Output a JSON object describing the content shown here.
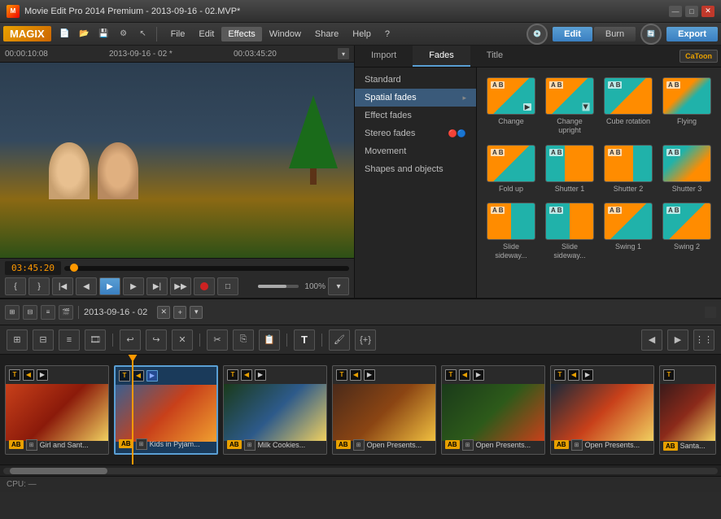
{
  "window": {
    "title": "Movie Edit Pro 2014 Premium - 2013-09-16 - 02.MVP*",
    "controls": [
      "—",
      "□",
      "✕"
    ]
  },
  "menu": {
    "logo": "MAGIX",
    "file": "File",
    "edit": "Edit",
    "effects": "Effects",
    "window": "Window",
    "share": "Share",
    "help": "Help",
    "edit_btn": "Edit",
    "burn_btn": "Burn",
    "export_btn": "Export"
  },
  "video": {
    "time_left": "00:00:10:08",
    "title": "2013-09-16 - 02 *",
    "time_right": "00:03:45:20",
    "playback_time": "03:45:20"
  },
  "effects_panel": {
    "tabs": [
      "Import",
      "Fades",
      "Title"
    ],
    "active_tab": "Fades",
    "catoon_badge": "CaToon",
    "list_items": [
      {
        "id": "standard",
        "label": "Standard",
        "has_arrow": false
      },
      {
        "id": "spatial_fades",
        "label": "Spatial fades",
        "has_arrow": true
      },
      {
        "id": "effect_fades",
        "label": "Effect fades",
        "has_arrow": false
      },
      {
        "id": "stereo_fades",
        "label": "Stereo fades",
        "has_arrow": false
      },
      {
        "id": "movement",
        "label": "Movement",
        "has_arrow": false
      },
      {
        "id": "shapes_objects",
        "label": "Shapes and objects",
        "has_arrow": false
      }
    ],
    "grid_items": [
      {
        "id": "change",
        "label": "Change",
        "style": "fade-change"
      },
      {
        "id": "change_upright",
        "label": "Change upright",
        "style": "fade-change-upright"
      },
      {
        "id": "cube_rotation",
        "label": "Cube rotation",
        "style": "fade-cube"
      },
      {
        "id": "flying",
        "label": "Flying",
        "style": "fade-flying"
      },
      {
        "id": "fold_up",
        "label": "Fold up",
        "style": "fade-fold"
      },
      {
        "id": "shutter1",
        "label": "Shutter 1",
        "style": "fade-shutter1"
      },
      {
        "id": "shutter2",
        "label": "Shutter 2",
        "style": "fade-shutter2"
      },
      {
        "id": "shutter3",
        "label": "Shutter 3",
        "style": "fade-shutter3"
      },
      {
        "id": "slide_sideway1",
        "label": "Slide sideway...",
        "style": "fade-slide1"
      },
      {
        "id": "slide_sideway2",
        "label": "Slide sideway...",
        "style": "fade-slide2"
      },
      {
        "id": "swing1",
        "label": "Swing 1",
        "style": "fade-swing1"
      },
      {
        "id": "swing2",
        "label": "Swing 2",
        "style": "fade-swing2"
      }
    ]
  },
  "playback": {
    "time": "03:45:20",
    "zoom": "100%",
    "controls": [
      "in_mark",
      "out_mark",
      "prev_scene",
      "prev_frame",
      "play",
      "next_frame",
      "next_scene",
      "end"
    ]
  },
  "timeline": {
    "title": "2013-09-16 - 02",
    "clips": [
      {
        "id": "clip1",
        "name": "Girl and Sant...",
        "bg": "clip-bg-1"
      },
      {
        "id": "clip2",
        "name": "Kids in Pyjam...",
        "bg": "clip-bg-2",
        "selected": true
      },
      {
        "id": "clip3",
        "name": "Milk Cookies...",
        "bg": "clip-bg-3"
      },
      {
        "id": "clip4",
        "name": "Open Presents...",
        "bg": "clip-bg-4"
      },
      {
        "id": "clip5",
        "name": "Open Presents...",
        "bg": "clip-bg-5"
      },
      {
        "id": "clip6",
        "name": "Open Presents...",
        "bg": "clip-bg-6"
      },
      {
        "id": "clip7",
        "name": "Santa...",
        "bg": "clip-bg-7"
      }
    ]
  },
  "status": {
    "text": "CPU: —"
  },
  "icons": {
    "play": "▶",
    "pause": "⏸",
    "stop": "■",
    "prev": "◀◀",
    "next": "▶▶",
    "start": "⏮",
    "end": "⏭",
    "undo": "↩",
    "redo": "↪",
    "cut": "✂",
    "copy": "⎘",
    "paste": "📋",
    "text": "T",
    "brush": "🖌",
    "arrow_down": "▾",
    "arrow_right": "▸",
    "close": "✕",
    "add": "+",
    "settings": "⚙",
    "wrench": "🔧"
  }
}
